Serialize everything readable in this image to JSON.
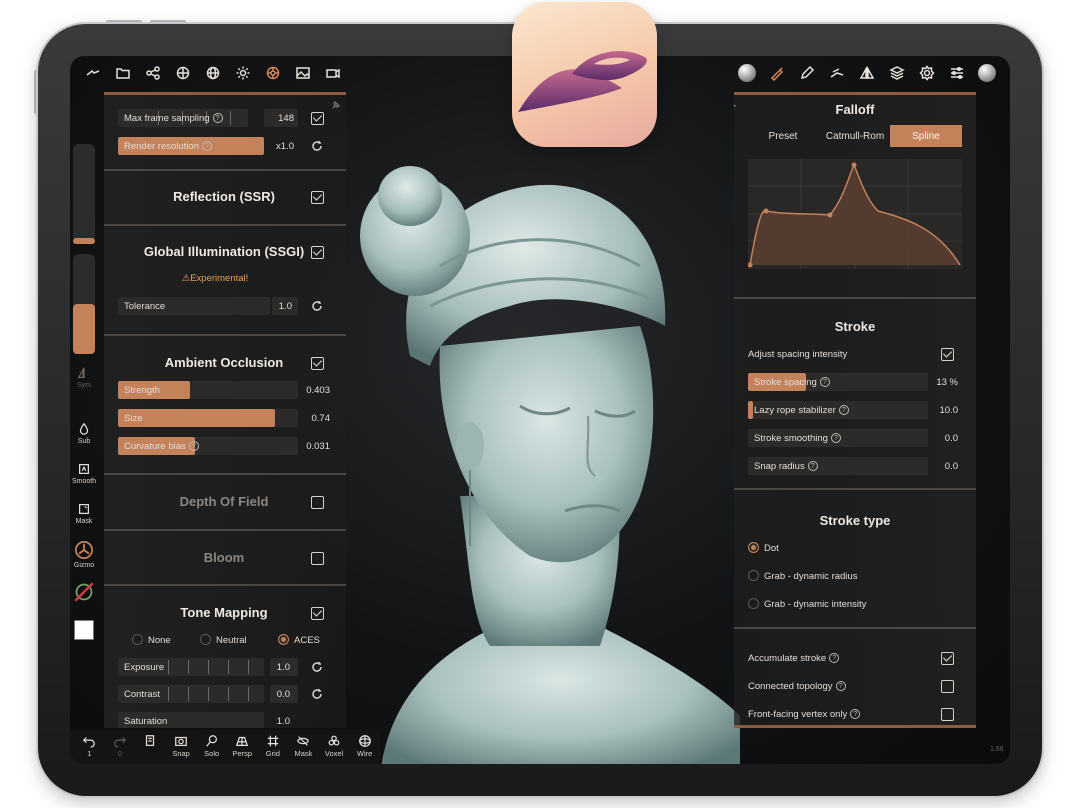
{
  "colors": {
    "accent": "#c4825a",
    "panel": "#222121",
    "background": "#121314",
    "warning": "#e0a35a"
  },
  "topbar": {
    "left_icons": [
      "mirror-icon",
      "folder-icon",
      "share-icon",
      "lighting-icon",
      "globe-icon",
      "sun-icon",
      "material-icon",
      "image-icon",
      "camera-icon"
    ],
    "right_icons": [
      "matcap-sphere-icon",
      "brush-icon",
      "pen-icon",
      "smudge-icon",
      "symmetry-icon",
      "layers-icon",
      "settings-icon",
      "sliders-icon",
      "material-sphere-icon"
    ]
  },
  "rail": {
    "sym_label": "Sym",
    "sub_label": "Sub",
    "smooth_label": "Smooth",
    "mask_label": "Mask",
    "gizmo_label": "Gizmo"
  },
  "left_panel": {
    "max_frame_label": "Max frame sampling",
    "max_frame_value": "148",
    "render_res_label": "Render resolution",
    "render_res_value": "x1.0",
    "ssr_title": "Reflection (SSR)",
    "ssgi_title": "Global Illumination (SSGI)",
    "ssgi_warning": "Experimental!",
    "tolerance_label": "Tolerance",
    "tolerance_value": "1.0",
    "ao_title": "Ambient Occlusion",
    "strength_label": "Strength",
    "strength_value": "0.403",
    "strength_fill": 0.4,
    "size_label": "Size",
    "size_value": "0.74",
    "size_fill": 0.87,
    "curv_label": "Curvature bias",
    "curv_value": "0.031",
    "curv_fill": 0.43,
    "dof_title": "Depth Of Field",
    "bloom_title": "Bloom",
    "tone_title": "Tone Mapping",
    "tone_options": [
      "None",
      "Neutral",
      "ACES"
    ],
    "exposure_label": "Exposure",
    "exposure_value": "1.0",
    "contrast_label": "Contrast",
    "contrast_value": "0.0",
    "saturation_label": "Saturation",
    "saturation_value": "1.0"
  },
  "right_panel": {
    "falloff_title": "Falloff",
    "presets": [
      "Preset",
      "Catmull-Rom",
      "Spline"
    ],
    "stroke_title": "Stroke",
    "adjust_spacing_label": "Adjust spacing intensity",
    "stroke_spacing_label": "Stroke spacing",
    "stroke_spacing_value": "13 %",
    "stroke_spacing_fill": 0.32,
    "lazy_label": "Lazy rope stabilizer",
    "lazy_value": "10.0",
    "lazy_fill": 0.03,
    "smoothing_label": "Stroke smoothing",
    "smoothing_value": "0.0",
    "snap_label": "Snap radius",
    "snap_value": "0.0",
    "stroke_type_title": "Stroke type",
    "stroke_types": [
      "Dot",
      "Grab - dynamic radius",
      "Grab - dynamic intensity"
    ],
    "accumulate_label": "Accumulate stroke",
    "connected_label": "Connected topology",
    "frontfacing_label": "Front-facing vertex only"
  },
  "bottombar": {
    "items": [
      "1",
      "0",
      "",
      "Snap",
      "Solo",
      "Persp",
      "Grid",
      "Mask",
      "Voxel",
      "Wire"
    ]
  },
  "version": "1.66"
}
